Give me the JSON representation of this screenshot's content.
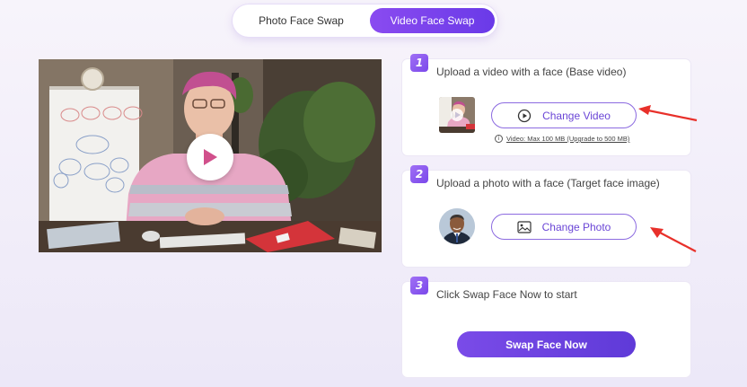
{
  "tabs": {
    "photo_label": "Photo Face Swap",
    "video_label": "Video Face Swap",
    "active": "Video Face Swap"
  },
  "preview": {
    "play_icon": "play-icon"
  },
  "step1": {
    "number": "1",
    "text": "Upload a video with a face (Base video)",
    "button_label": "Change Video",
    "button_icon": "play-circle-icon",
    "note": "Video: Max 100 MB (Upgrade to 500 MB)"
  },
  "step2": {
    "number": "2",
    "text": "Upload a photo with a face (Target face image)",
    "button_label": "Change Photo",
    "button_icon": "image-icon"
  },
  "step3": {
    "number": "3",
    "text": "Click Swap Face Now to start",
    "button_label": "Swap Face Now"
  },
  "colors": {
    "accent": "#6a3ae8",
    "accent_light": "#a070f5",
    "arrow": "#e8302a"
  }
}
